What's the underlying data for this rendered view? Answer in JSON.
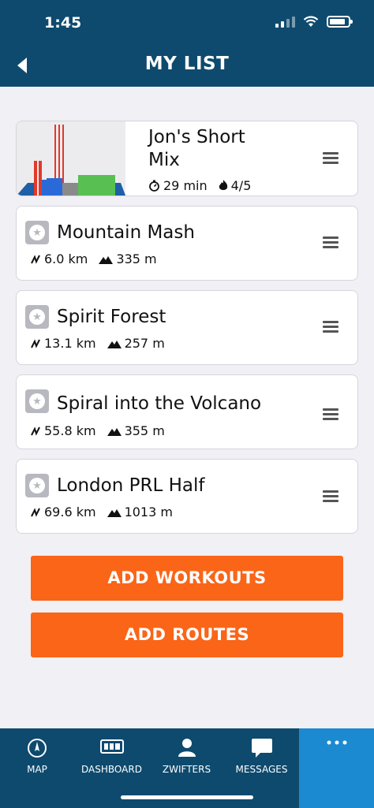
{
  "status_bar": {
    "time": "1:45"
  },
  "header": {
    "title": "MY LIST",
    "back_icon": "chevron-left-icon"
  },
  "workout": {
    "title_line1": "Jon's Short",
    "title_line2": "Mix",
    "duration": "29 min",
    "difficulty": "4/5",
    "duration_icon": "stopwatch-icon",
    "difficulty_icon": "flame-icon"
  },
  "routes": [
    {
      "name": "Mountain Mash",
      "distance": "6.0 km",
      "elevation": "335 m"
    },
    {
      "name": "Spirit Forest",
      "distance": "13.1 km",
      "elevation": "257 m"
    },
    {
      "name": "Spiral into the Volcano",
      "distance": "55.8 km",
      "elevation": "355 m"
    },
    {
      "name": "London PRL Half",
      "distance": "69.6 km",
      "elevation": "1013 m"
    }
  ],
  "buttons": {
    "add_workouts": "ADD WORKOUTS",
    "add_routes": "ADD ROUTES"
  },
  "tabs": [
    {
      "label": "MAP",
      "icon": "compass-icon"
    },
    {
      "label": "DASHBOARD",
      "icon": "dashboard-icon"
    },
    {
      "label": "ZWIFTERS",
      "icon": "person-icon"
    },
    {
      "label": "MESSAGES",
      "icon": "chat-bubble-icon"
    },
    {
      "label": "",
      "icon": "more-dots-icon"
    }
  ],
  "colors": {
    "header_bg": "#0e4a6e",
    "accent": "#fa6518",
    "active_tab": "#1c8ad0"
  }
}
